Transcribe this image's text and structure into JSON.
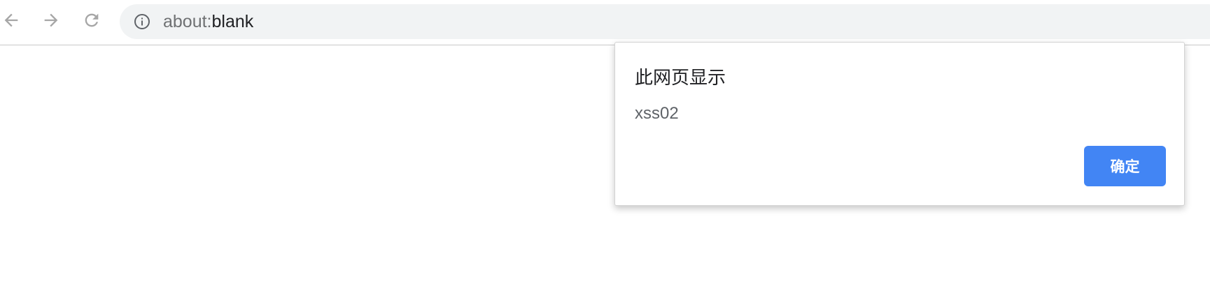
{
  "browser": {
    "nav": {
      "back_icon": "arrow-left-icon",
      "forward_icon": "arrow-right-icon",
      "reload_icon": "reload-icon"
    },
    "omnibox": {
      "info_icon": "info-icon",
      "url_scheme": "about:",
      "url_rest": "blank"
    }
  },
  "dialog": {
    "title": "此网页显示",
    "message": "xss02",
    "ok_label": "确定"
  },
  "colors": {
    "accent": "#4285f4",
    "omnibox_bg": "#f1f3f4",
    "icon_gray": "#a6a6a6"
  }
}
